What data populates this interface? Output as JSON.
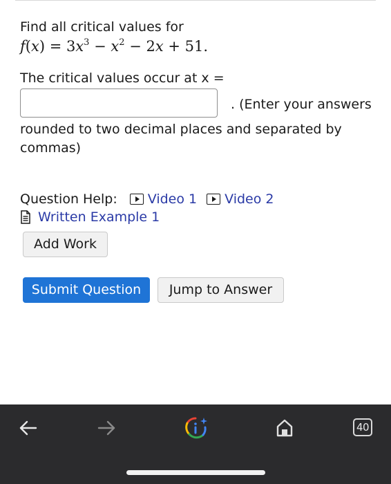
{
  "question": {
    "prompt": "Find all critical values for",
    "function_parts": {
      "f": "f",
      "x1": "x",
      "eq": ") = 3",
      "x2": "x",
      "exp3": "3",
      "minus1": " − ",
      "x3": "x",
      "exp2": "2",
      "minus2": " − 2",
      "x4": "x",
      "tail": " + 51."
    },
    "answer_label": "The critical values occur at x =",
    "answer_value": "",
    "answer_suffix": ". (Enter your answers",
    "instructions": "rounded to two decimal places and separated by commas)"
  },
  "help": {
    "label": "Question Help:",
    "video1": "Video 1",
    "video2": "Video 2",
    "written_example": "Written Example 1"
  },
  "buttons": {
    "add_work": "Add Work",
    "submit": "Submit Question",
    "jump": "Jump to Answer"
  },
  "browser_nav": {
    "back_icon": "back-arrow-icon",
    "forward_icon": "forward-arrow-icon",
    "assistant_icon": "google-assistant-icon",
    "home_icon": "home-icon",
    "tab_count": "40"
  },
  "colors": {
    "link": "#2a3aa6",
    "primary_button": "#1f74d6",
    "navbar": "#2b2b2d"
  }
}
